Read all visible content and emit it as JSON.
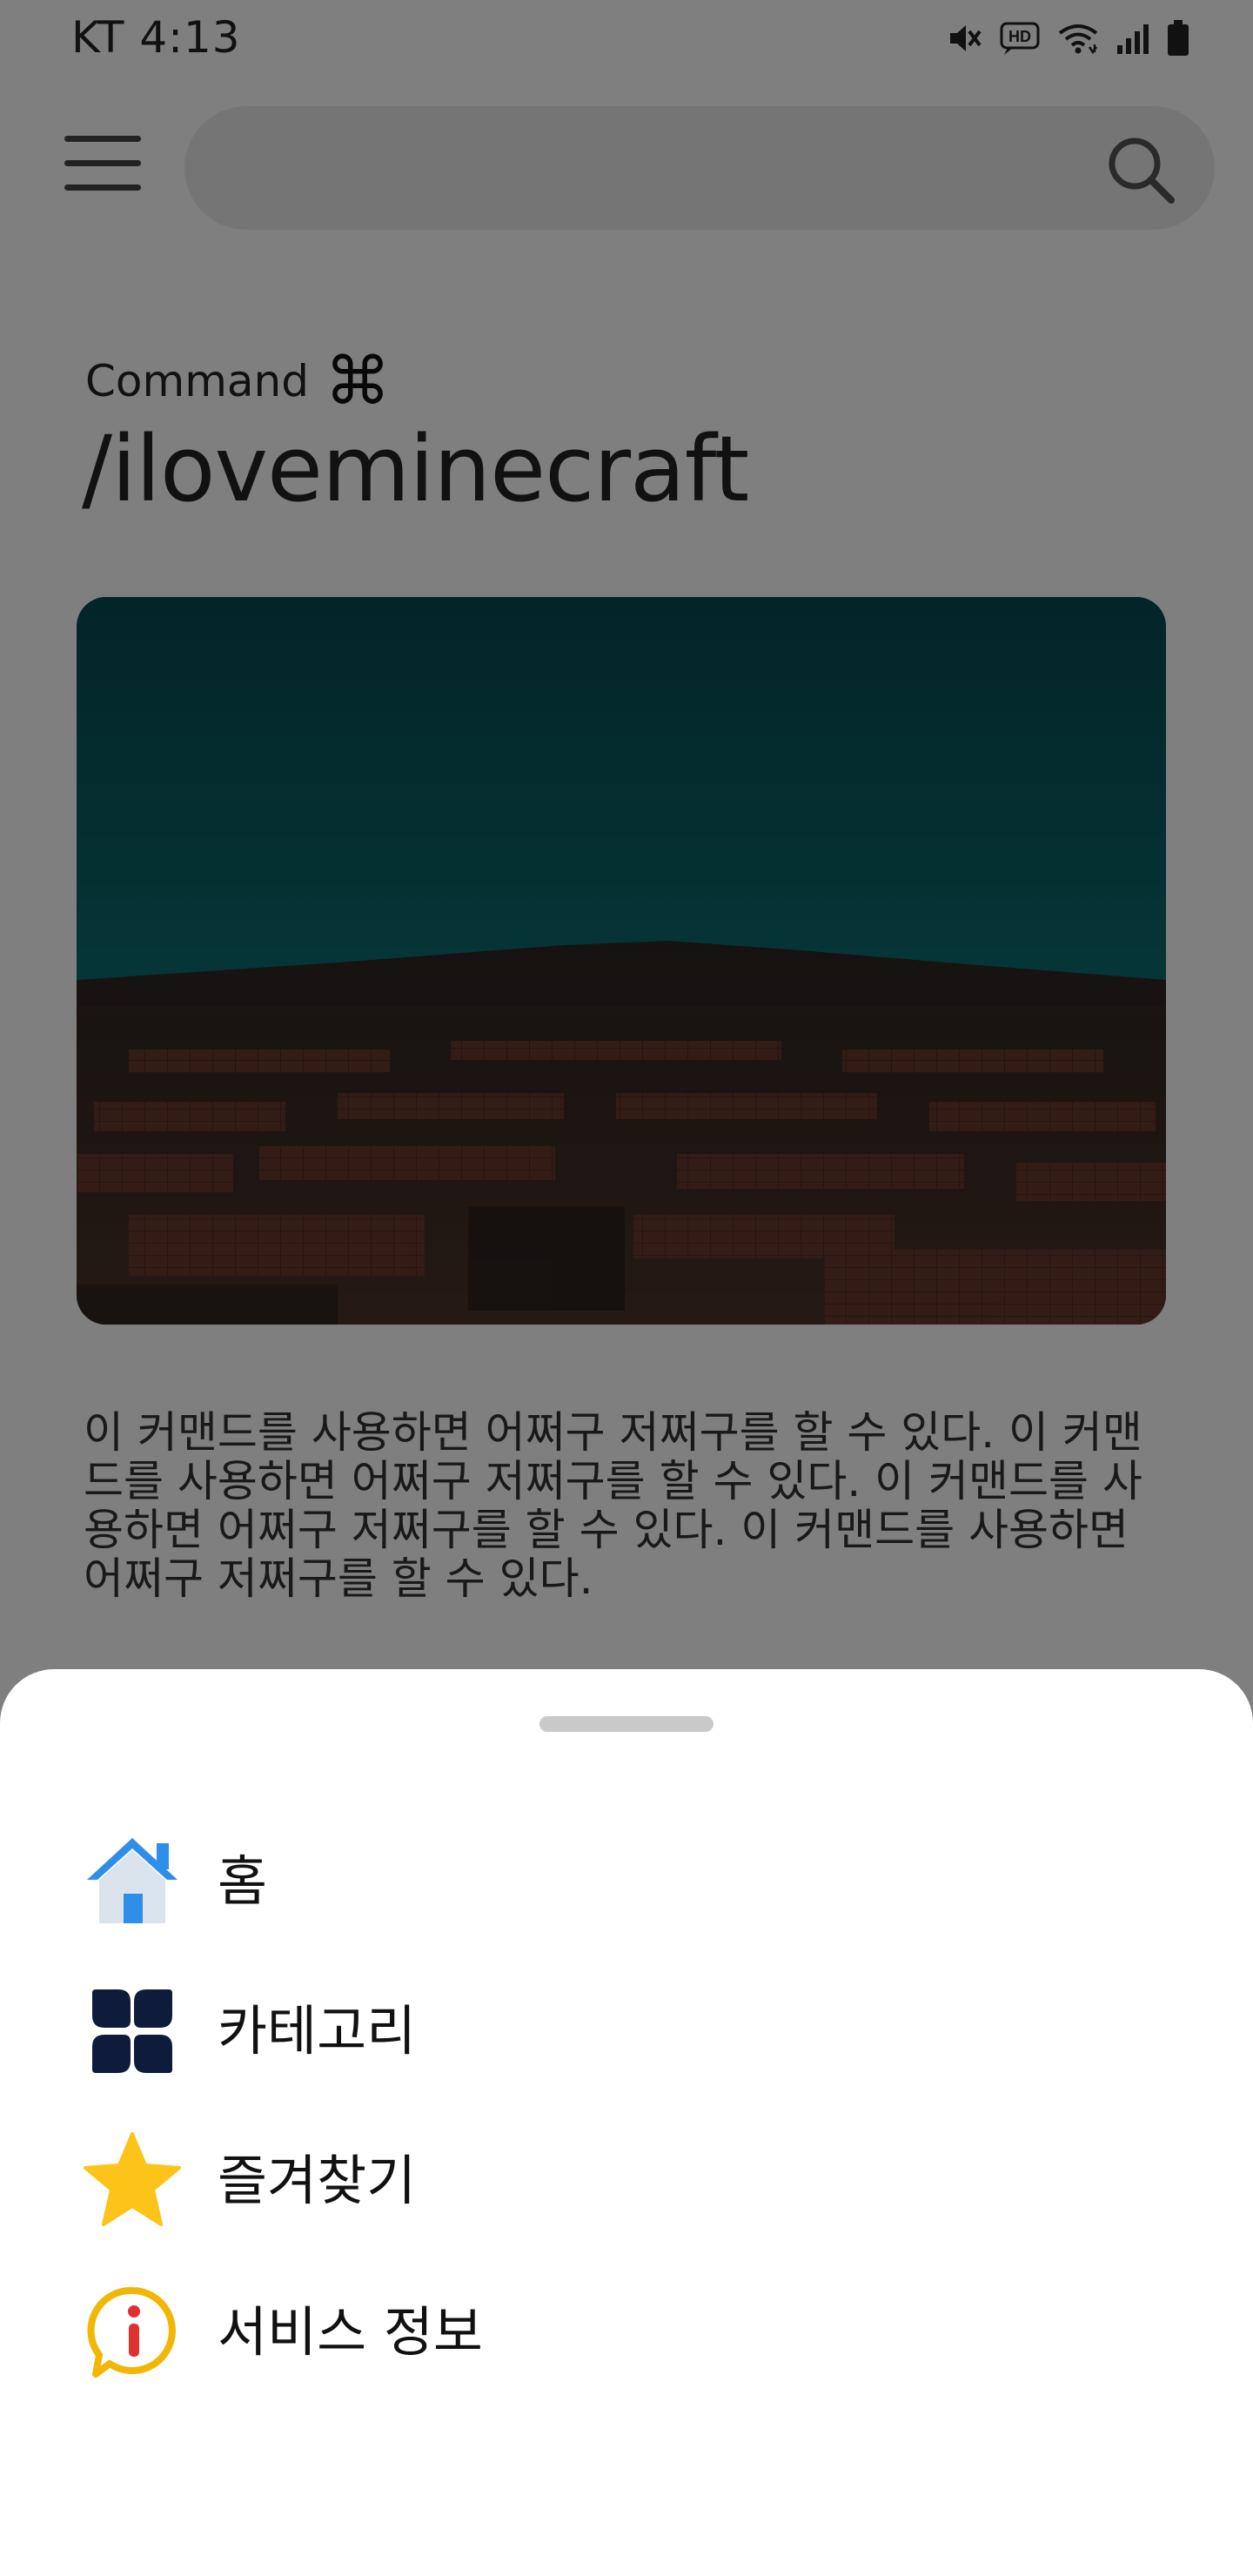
{
  "status_bar": {
    "carrier_time": "KT 4:13",
    "icons": [
      "mute-icon",
      "hd-volte-icon",
      "wifi-icon",
      "signal-icon",
      "battery-icon"
    ]
  },
  "header": {
    "menu_icon": "menu-icon",
    "search": {
      "value": "",
      "placeholder": "",
      "icon": "search-icon"
    }
  },
  "command": {
    "label": "Command",
    "symbol": "⌘",
    "title": "/iloveminecraft",
    "description": "이 커맨드를 사용하면 어쩌구 저쩌구를 할 수 있다. 이 커맨드를 사용하면 어쩌구 저쩌구를 할 수 있다. 이 커맨드를 사용하면 어쩌구 저쩌구를 할 수 있다. 이 커맨드를 사용하면 어쩌구 저쩌구를 할 수 있다."
  },
  "sheet": {
    "items": [
      {
        "label": "홈",
        "icon": "home-icon"
      },
      {
        "label": "카테고리",
        "icon": "category-icon"
      },
      {
        "label": "즐겨찾기",
        "icon": "star-icon"
      },
      {
        "label": "서비스 정보",
        "icon": "info-icon"
      }
    ]
  },
  "colors": {
    "scrim": "#000000",
    "home_blue": "#2196f3",
    "category_navy": "#0f1b3a",
    "star_yellow": "#fcc419",
    "info_yellow": "#f2b705",
    "info_red": "#e03131",
    "hero_teal": "#0b6a6e"
  }
}
